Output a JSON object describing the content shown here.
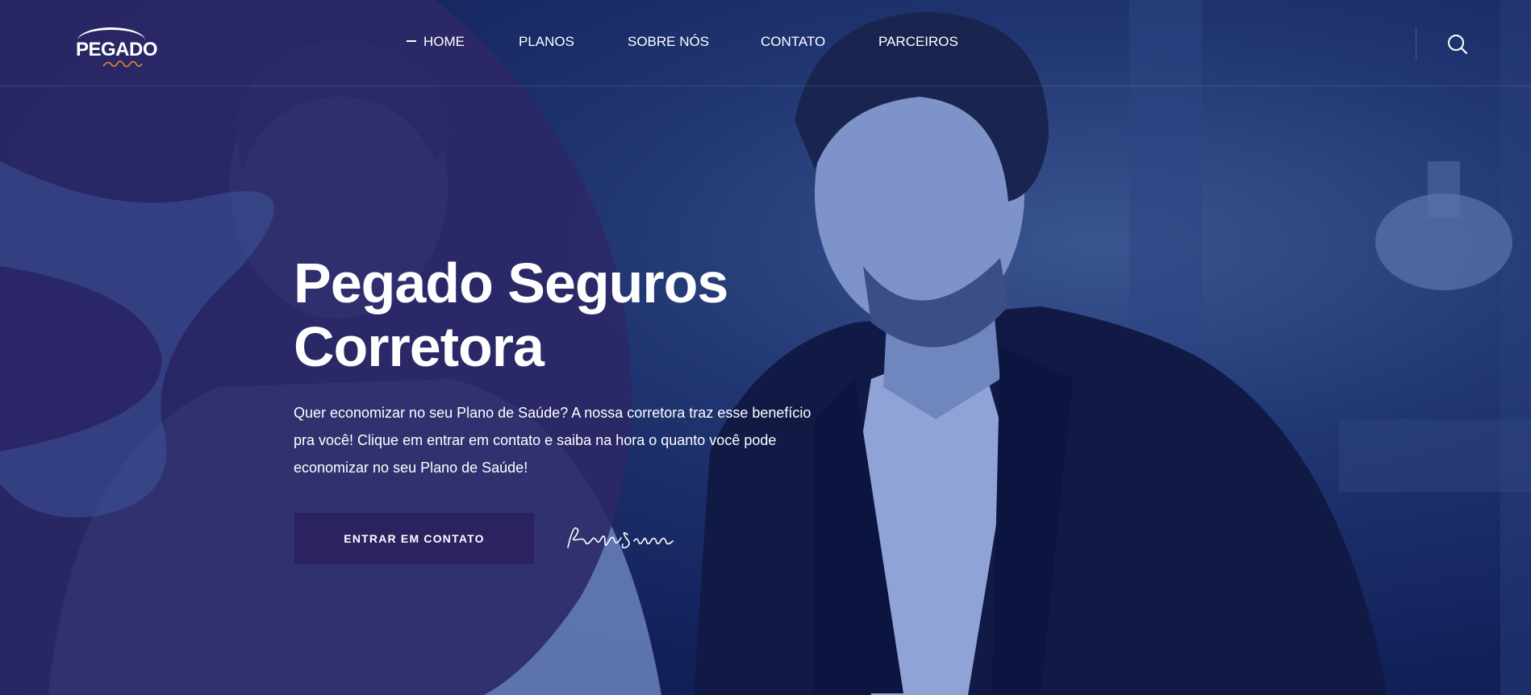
{
  "brand": {
    "logo_text": "PEGADO",
    "logo_script": "Seguros"
  },
  "nav": {
    "items": [
      {
        "label": "HOME",
        "active": true
      },
      {
        "label": "PLANOS",
        "active": false
      },
      {
        "label": "SOBRE NÓS",
        "active": false
      },
      {
        "label": "CONTATO",
        "active": false
      },
      {
        "label": "PARCEIROS",
        "active": false
      }
    ],
    "search_icon": "search-icon"
  },
  "hero": {
    "title_line1": "Pegado Seguros",
    "title_line2": "Corretora",
    "description": "Quer economizar no seu Plano de Saúde? A nossa corretora traz esse benefício pra você! Clique em entrar em contato e saiba na hora o quanto você pode economizar no seu Plano de Saúde!",
    "cta_label": "ENTRAR EM CONTATO",
    "signature_text": "Pegado Seguros"
  },
  "colors": {
    "overlay_navy": "#0f1b4d",
    "shape_purple": "#2a2563",
    "cta_bg": "#2a2360",
    "logo_accent": "#e08a3c",
    "text": "#ffffff"
  }
}
